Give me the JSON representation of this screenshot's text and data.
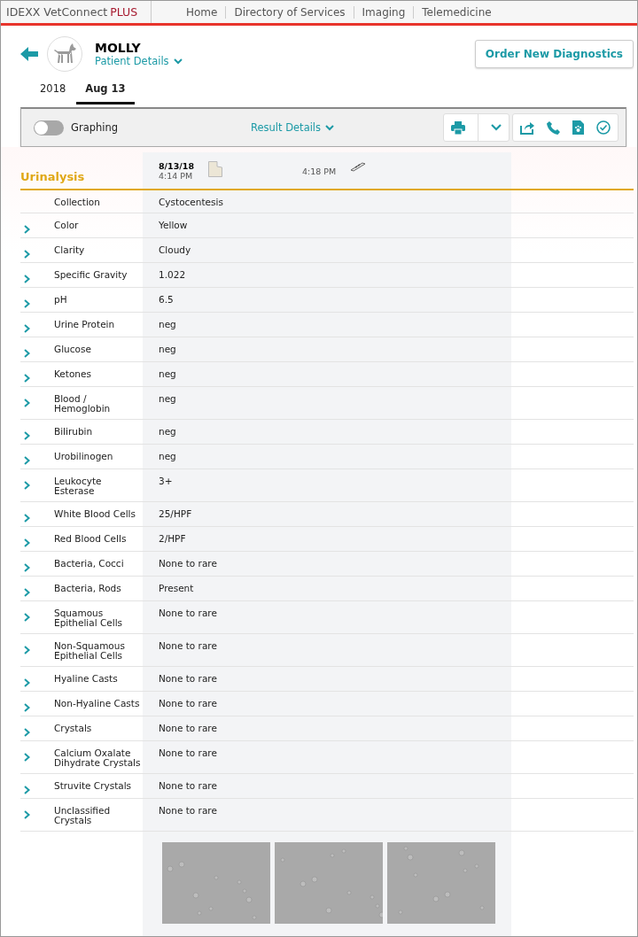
{
  "brand": {
    "name": "IDEXX VetConnect",
    "plus": "PLUS"
  },
  "nav": [
    "Home",
    "Directory of Services",
    "Imaging",
    "Telemedicine"
  ],
  "patient": {
    "name": "MOLLY",
    "details_link": "Patient Details"
  },
  "order_button": "Order New Diagnostics",
  "date_tabs": [
    {
      "label": "2018",
      "selected": false
    },
    {
      "label": "Aug 13",
      "selected": true
    }
  ],
  "toolbar": {
    "graphing": {
      "label": "Graphing",
      "on": false
    },
    "result_details": "Result Details"
  },
  "section": {
    "title": "Urinalysis",
    "date": "8/13/18",
    "time_1": "4:14 PM",
    "time_2": "4:18 PM"
  },
  "rows": [
    {
      "name": "Collection",
      "value": "Cystocentesis",
      "expandable": false
    },
    {
      "name": "Color",
      "value": "Yellow",
      "expandable": true
    },
    {
      "name": "Clarity",
      "value": "Cloudy",
      "expandable": true
    },
    {
      "name": "Specific Gravity",
      "value": "1.022",
      "expandable": true
    },
    {
      "name": "pH",
      "value": "6.5",
      "expandable": true
    },
    {
      "name": "Urine Protein",
      "value": "neg",
      "expandable": true
    },
    {
      "name": "Glucose",
      "value": "neg",
      "expandable": true
    },
    {
      "name": "Ketones",
      "value": "neg",
      "expandable": true
    },
    {
      "name": "Blood / Hemoglobin",
      "value": "neg",
      "expandable": true
    },
    {
      "name": "Bilirubin",
      "value": "neg",
      "expandable": true
    },
    {
      "name": "Urobilinogen",
      "value": "neg",
      "expandable": true
    },
    {
      "name": "Leukocyte Esterase",
      "value": "3+",
      "expandable": true
    },
    {
      "name": "White Blood Cells",
      "value": "25/HPF",
      "expandable": true
    },
    {
      "name": "Red Blood Cells",
      "value": "2/HPF",
      "expandable": true
    },
    {
      "name": "Bacteria, Cocci",
      "value": "None to rare",
      "expandable": true
    },
    {
      "name": "Bacteria, Rods",
      "value": "Present",
      "expandable": true
    },
    {
      "name": "Squamous Epithelial Cells",
      "value": "None to rare",
      "expandable": true
    },
    {
      "name": "Non-Squamous Epithelial Cells",
      "value": "None to rare",
      "expandable": true
    },
    {
      "name": "Hyaline Casts",
      "value": "None to rare",
      "expandable": true
    },
    {
      "name": "Non-Hyaline Casts",
      "value": "None to rare",
      "expandable": true
    },
    {
      "name": "Crystals",
      "value": "None to rare",
      "expandable": true
    },
    {
      "name": "Calcium Oxalate Dihydrate Crystals",
      "value": "None to rare",
      "expandable": true
    },
    {
      "name": "Struvite Crystals",
      "value": "None to rare",
      "expandable": true
    },
    {
      "name": "Unclassified Crystals",
      "value": "None to rare",
      "expandable": true
    }
  ]
}
